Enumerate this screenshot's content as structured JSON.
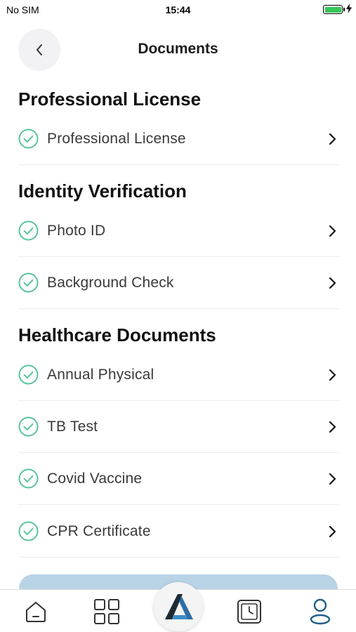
{
  "status_bar": {
    "carrier": "No SIM",
    "time": "15:44",
    "battery_level": 1.0,
    "battery_color": "#34c759"
  },
  "header": {
    "title": "Documents",
    "back_icon": "chevron-left-icon"
  },
  "sections": [
    {
      "title": "Professional License",
      "items": [
        {
          "label": "Professional License",
          "status": "complete"
        }
      ]
    },
    {
      "title": "Identity Verification",
      "items": [
        {
          "label": "Photo ID",
          "status": "complete"
        },
        {
          "label": "Background Check",
          "status": "complete"
        }
      ]
    },
    {
      "title": "Healthcare Documents",
      "items": [
        {
          "label": "Annual Physical",
          "status": "complete"
        },
        {
          "label": "TB Test",
          "status": "complete"
        },
        {
          "label": "Covid Vaccine",
          "status": "complete"
        },
        {
          "label": "CPR Certificate",
          "status": "complete"
        }
      ]
    }
  ],
  "colors": {
    "check": "#5cc49a",
    "active_tab": "#1f5f8b",
    "inactive_tab": "#333333",
    "action_button": "#b9d3e6"
  },
  "tab_bar": {
    "tabs": [
      {
        "icon": "home-icon",
        "active": false
      },
      {
        "icon": "grid-icon",
        "active": false
      },
      {
        "icon": "app-logo-icon",
        "active": false
      },
      {
        "icon": "clock-icon",
        "active": false
      },
      {
        "icon": "profile-icon",
        "active": true
      }
    ]
  }
}
